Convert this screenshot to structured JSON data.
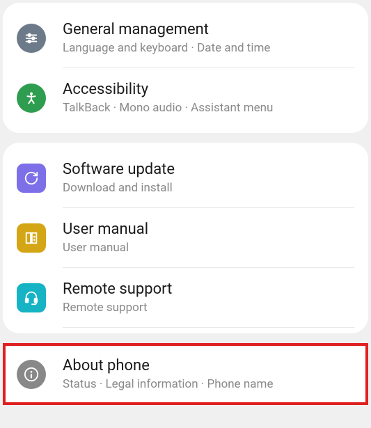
{
  "group1": {
    "items": [
      {
        "title": "General management",
        "subtitle": "Language and keyboard  ·  Date and time"
      },
      {
        "title": "Accessibility",
        "subtitle": "TalkBack  ·  Mono audio  ·  Assistant menu"
      }
    ]
  },
  "group2": {
    "items": [
      {
        "title": "Software update",
        "subtitle": "Download and install"
      },
      {
        "title": "User manual",
        "subtitle": "User manual"
      },
      {
        "title": "Remote support",
        "subtitle": "Remote support"
      },
      {
        "title": "About phone",
        "subtitle": "Status  ·  Legal information  ·  Phone name"
      }
    ]
  }
}
